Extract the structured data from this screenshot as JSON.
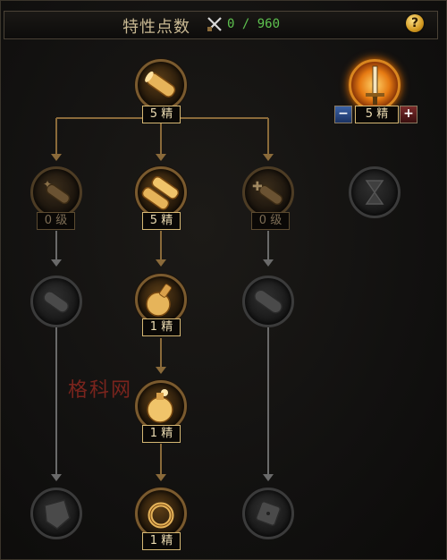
{
  "header": {
    "title": "特性点数",
    "points_value": "0 / 960",
    "help_label": "?"
  },
  "nodes": [
    {
      "id": "top",
      "state": "active",
      "icon": "scroll-icon",
      "level": "5 精"
    },
    {
      "id": "left-1",
      "state": "locked",
      "icon": "scroll-sparkle-icon",
      "level": "0 级"
    },
    {
      "id": "mid-1",
      "state": "active",
      "icon": "twin-scroll-icon",
      "level": "5 精"
    },
    {
      "id": "right-1",
      "state": "locked",
      "icon": "scroll-plus-icon",
      "level": "0 级"
    },
    {
      "id": "left-2",
      "state": "disabled",
      "icon": "scroll-icon"
    },
    {
      "id": "mid-2",
      "state": "active",
      "icon": "potion-icon",
      "level": "1 精"
    },
    {
      "id": "right-2",
      "state": "disabled",
      "icon": "capsule-icon"
    },
    {
      "id": "mid-3",
      "state": "active",
      "icon": "flask-icon",
      "level": "1 精"
    },
    {
      "id": "left-4",
      "state": "disabled",
      "icon": "gauntlet-icon"
    },
    {
      "id": "mid-4",
      "state": "active",
      "icon": "ring-icon",
      "level": "1 精"
    },
    {
      "id": "right-4",
      "state": "disabled",
      "icon": "dice-icon"
    },
    {
      "id": "special",
      "state": "fire",
      "icon": "sword-icon",
      "level": "5 精"
    },
    {
      "id": "special-2",
      "state": "disabled",
      "icon": "hourglass-icon"
    }
  ],
  "controls": {
    "minus": "−",
    "plus": "+"
  },
  "watermark": "格科网"
}
